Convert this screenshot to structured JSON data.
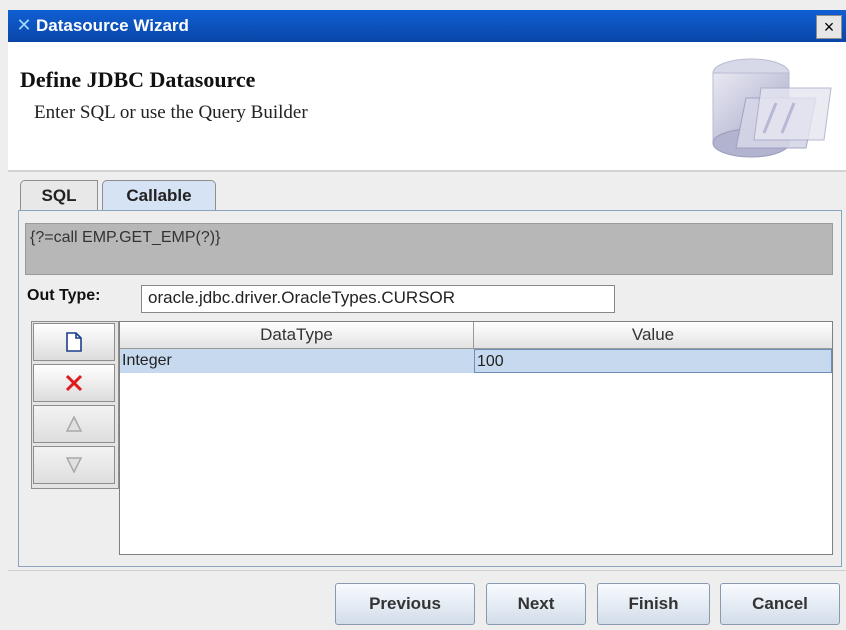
{
  "window": {
    "title": "Datasource Wizard",
    "close_label": "×"
  },
  "header": {
    "title": "Define JDBC Datasource",
    "subtitle": "Enter SQL or use the Query Builder"
  },
  "tabs": [
    {
      "label": "SQL"
    },
    {
      "label": "Callable"
    }
  ],
  "callable": {
    "sql": "{?=call EMP.GET_EMP(?)}",
    "out_type_label": "Out Type:",
    "out_type_value": "oracle.jdbc.driver.OracleTypes.CURSOR"
  },
  "table": {
    "columns": [
      "DataType",
      "Value"
    ],
    "rows": [
      {
        "datatype": "Integer",
        "value": "100"
      }
    ]
  },
  "param_buttons": [
    {
      "name": "new-icon"
    },
    {
      "name": "delete-icon"
    },
    {
      "name": "move-up-icon"
    },
    {
      "name": "move-down-icon"
    }
  ],
  "footer": {
    "previous": "Previous",
    "next": "Next",
    "finish": "Finish",
    "cancel": "Cancel"
  }
}
